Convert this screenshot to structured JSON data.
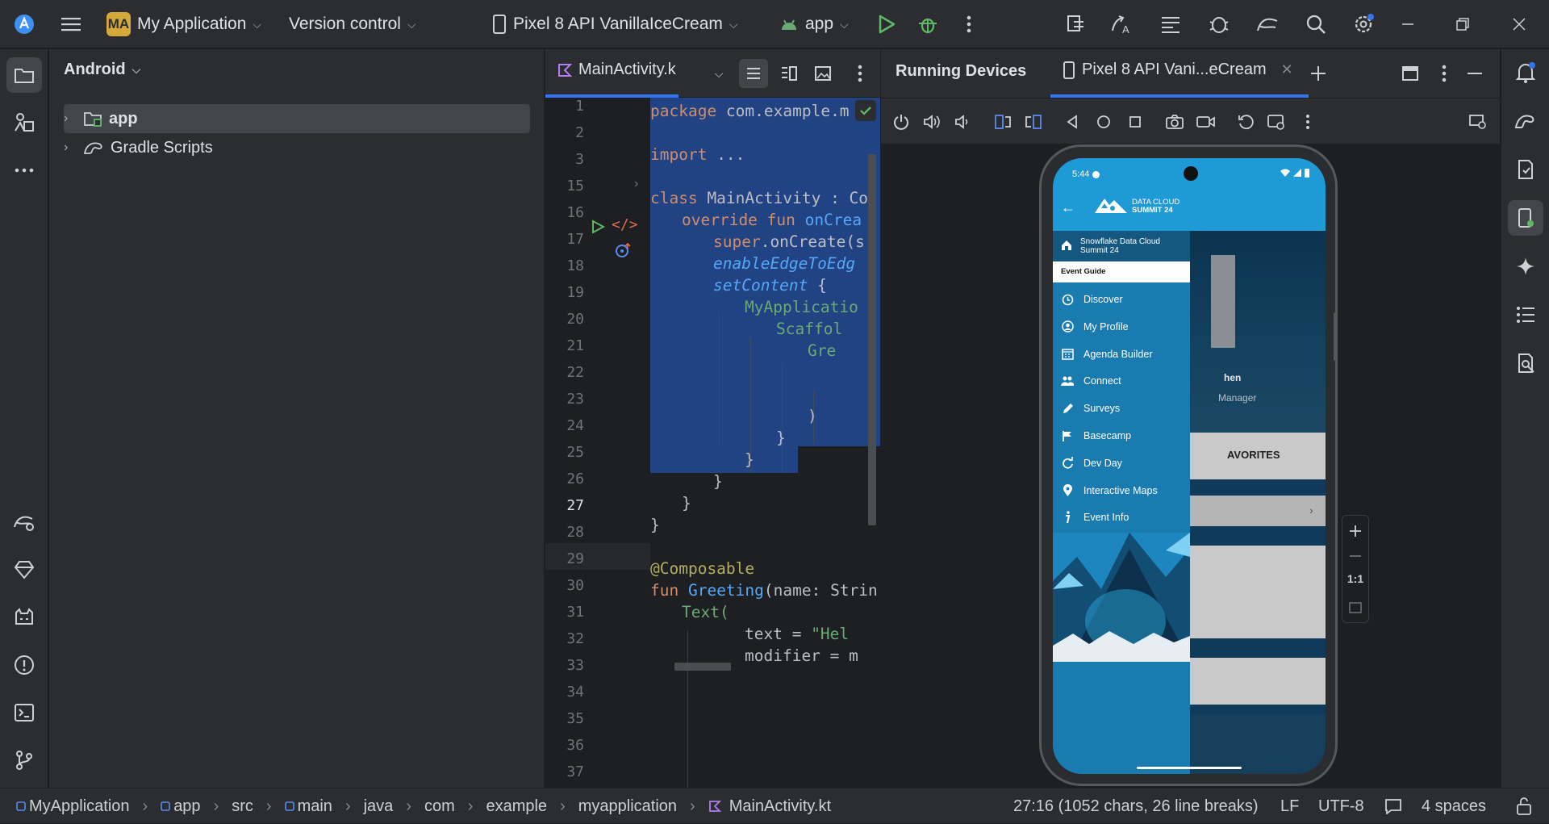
{
  "titlebar": {
    "project_badge": "MA",
    "project_name": "My Application",
    "vcs": "Version control",
    "device": "Pixel 8 API VanillaIceCream",
    "run_config": "app"
  },
  "project_panel": {
    "view": "Android",
    "items": [
      {
        "label": "app"
      },
      {
        "label": "Gradle Scripts"
      }
    ]
  },
  "editor": {
    "tab": "MainActivity.k",
    "line_numbers": [
      "1",
      "2",
      "3",
      "15",
      "16",
      "17",
      "18",
      "19",
      "20",
      "21",
      "22",
      "23",
      "24",
      "25",
      "26",
      "27",
      "28",
      "29",
      "30",
      "31",
      "32",
      "33",
      "34",
      "35",
      "36",
      "37"
    ],
    "current_line": "27",
    "code": {
      "l1a": "package",
      "l1b": " com.example.m",
      "l3a": "import",
      "l3b": " ...",
      "l16a": "class",
      "l16b": " MainActivity : Co",
      "l17a": "override fun",
      "l17b": " onCrea",
      "l18a": "super",
      "l18b": ".onCreate(s",
      "l19": "enableEdgeToEdg",
      "l20a": "setContent",
      "l20b": " {",
      "l21": "MyApplicatio",
      "l22": "Scaffol",
      "l23": "Gre",
      "l26": ")",
      "l27": "}",
      "l28": "}",
      "l29": "}",
      "l30": "}",
      "l31": "}",
      "l33": "@Composable",
      "l34a": "fun",
      "l34b": " Greeting",
      "l34c": "(name: Strin",
      "l35": "Text(",
      "l36a": "text = ",
      "l36b": "\"Hel",
      "l37": "modifier = m"
    }
  },
  "devices": {
    "title": "Running Devices",
    "tab": "Pixel 8 API Vani...eCream",
    "zoom_label": "1:1"
  },
  "app": {
    "time": "5:44",
    "logo_line1": "DATA CLOUD",
    "logo_line2": "SUMMIT 24",
    "home_item": "Snowflake Data Cloud Summit 24",
    "section": "Event Guide",
    "menu": [
      {
        "label": "Discover",
        "icon": "clock-icon"
      },
      {
        "label": "My Profile",
        "icon": "user-icon"
      },
      {
        "label": "Agenda Builder",
        "icon": "calendar-icon"
      },
      {
        "label": "Connect",
        "icon": "people-icon"
      },
      {
        "label": "Surveys",
        "icon": "pencil-icon"
      },
      {
        "label": "Basecamp",
        "icon": "flag-icon"
      },
      {
        "label": "Dev Day",
        "icon": "refresh-icon"
      },
      {
        "label": "Interactive Maps",
        "icon": "pin-icon"
      },
      {
        "label": "Event Info",
        "icon": "info-icon"
      }
    ],
    "behind": {
      "name_fragment": "hen",
      "role_fragment": "Manager",
      "favorites": "AVORITES"
    }
  },
  "statusbar": {
    "crumbs": [
      "MyApplication",
      "app",
      "src",
      "main",
      "java",
      "com",
      "example",
      "myapplication",
      "MainActivity.kt"
    ],
    "position": "27:16 (1052 chars, 26 line breaks)",
    "line_sep": "LF",
    "encoding": "UTF-8",
    "indent": "4 spaces"
  },
  "colors": {
    "selection": "#214283",
    "accent": "#3574f0",
    "app_blue": "#1e9ad6",
    "drawer": "#1a7bb0"
  }
}
